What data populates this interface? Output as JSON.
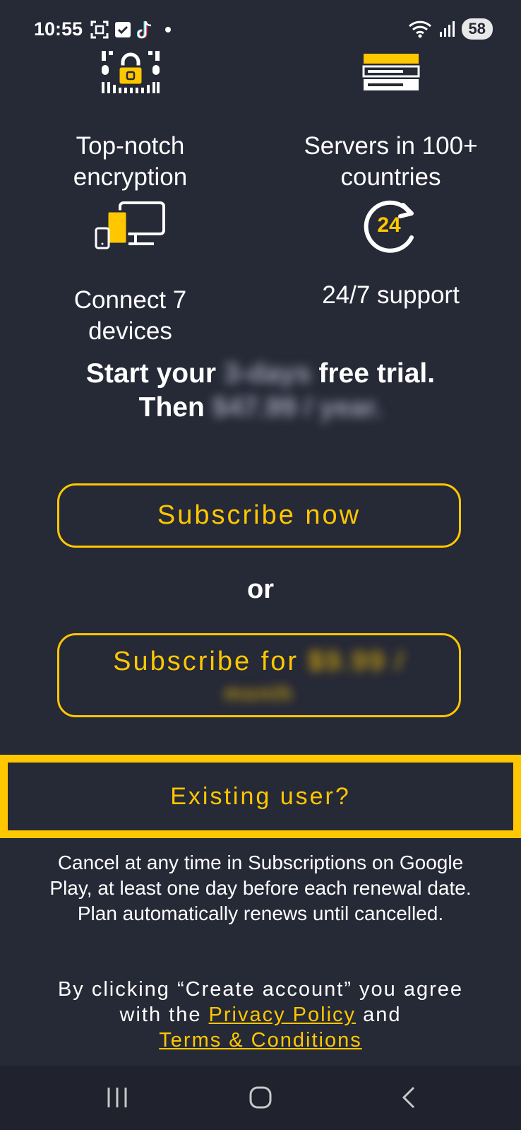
{
  "status": {
    "time": "10:55",
    "battery": "58"
  },
  "features": [
    {
      "label_line1": "Top-notch",
      "label_line2": "encryption",
      "icon": "padlock-icon"
    },
    {
      "label_line1": "Servers in 100+",
      "label_line2": "countries",
      "icon": "server-icon"
    },
    {
      "label_line1": "Connect 7",
      "label_line2": "devices",
      "icon": "devices-icon"
    },
    {
      "label_line1": "24/7 support",
      "label_line2": "",
      "icon": "support-24-icon"
    }
  ],
  "trial": {
    "prefix": "Start your",
    "trial_length": "3-days",
    "suffix": "free trial.",
    "then": "Then",
    "price": "$47.99 / year."
  },
  "buttons": {
    "subscribe_now": "Subscribe now",
    "or": "or",
    "subscribe_for": "Subscribe for",
    "subscribe_for_price_1": "$9.99 /",
    "subscribe_for_price_2": "month",
    "existing_user": "Existing user?"
  },
  "disclaimer": "Cancel at any time in Subscriptions on Google Play, at least one day before each renewal date. Plan automatically renews until cancelled.",
  "agree": {
    "prefix": "By clicking “Create account” you agree with the",
    "privacy": "Privacy Policy",
    "and": "and",
    "terms": "Terms & Conditions"
  },
  "colors": {
    "accent": "#ffc700",
    "background": "#262936"
  }
}
